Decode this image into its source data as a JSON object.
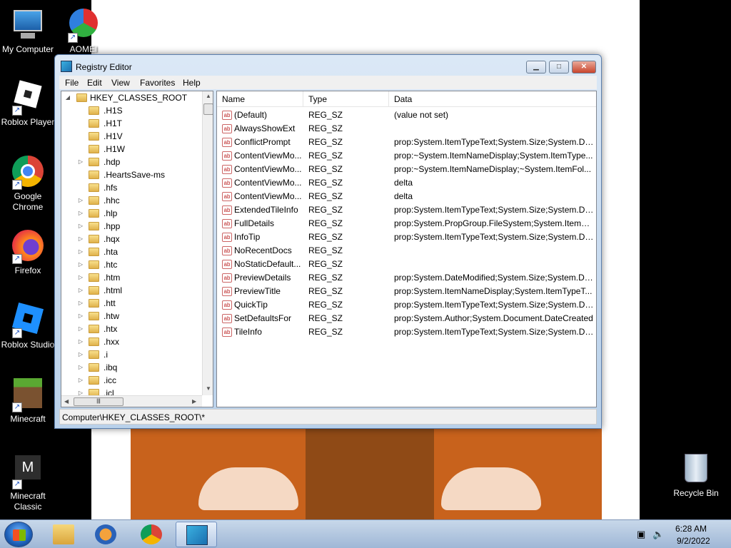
{
  "desktop": {
    "icons": [
      {
        "label": "My Computer",
        "icon": "computer-icon"
      },
      {
        "label": "AOMEI",
        "icon": "aomei-icon"
      },
      {
        "label": "Roblox Player",
        "icon": "roblox-icon"
      },
      {
        "label": "Google Chrome",
        "icon": "chrome-icon"
      },
      {
        "label": "Firefox",
        "icon": "firefox-icon"
      },
      {
        "label": "Roblox Studio",
        "icon": "roblox-studio-icon"
      },
      {
        "label": "Minecraft",
        "icon": "minecraft-icon"
      },
      {
        "label": "Minecraft Classic",
        "icon": "minecraft-classic-icon"
      },
      {
        "label": "Recycle Bin",
        "icon": "recycle-bin-icon"
      }
    ]
  },
  "window": {
    "title": "Registry Editor",
    "menu": [
      "File",
      "Edit",
      "View",
      "Favorites",
      "Help"
    ],
    "tree": {
      "root": "HKEY_CLASSES_ROOT",
      "items": [
        ".H1S",
        ".H1T",
        ".H1V",
        ".H1W",
        ".hdp",
        ".HeartsSave-ms",
        ".hfs",
        ".hhc",
        ".hlp",
        ".hpp",
        ".hqx",
        ".hta",
        ".htc",
        ".htm",
        ".html",
        ".htt",
        ".htw",
        ".htx",
        ".hxx",
        ".i",
        ".ibq",
        ".icc",
        ".icl"
      ]
    },
    "columns": {
      "name": "Name",
      "type": "Type",
      "data": "Data"
    },
    "values": [
      {
        "name": "(Default)",
        "type": "REG_SZ",
        "data": "(value not set)"
      },
      {
        "name": "AlwaysShowExt",
        "type": "REG_SZ",
        "data": ""
      },
      {
        "name": "ConflictPrompt",
        "type": "REG_SZ",
        "data": "prop:System.ItemTypeText;System.Size;System.Dat..."
      },
      {
        "name": "ContentViewMo...",
        "type": "REG_SZ",
        "data": "prop:~System.ItemNameDisplay;System.ItemType..."
      },
      {
        "name": "ContentViewMo...",
        "type": "REG_SZ",
        "data": "prop:~System.ItemNameDisplay;~System.ItemFol..."
      },
      {
        "name": "ContentViewMo...",
        "type": "REG_SZ",
        "data": "delta"
      },
      {
        "name": "ContentViewMo...",
        "type": "REG_SZ",
        "data": "delta"
      },
      {
        "name": "ExtendedTileInfo",
        "type": "REG_SZ",
        "data": "prop:System.ItemTypeText;System.Size;System.Dat..."
      },
      {
        "name": "FullDetails",
        "type": "REG_SZ",
        "data": "prop:System.PropGroup.FileSystem;System.ItemN..."
      },
      {
        "name": "InfoTip",
        "type": "REG_SZ",
        "data": "prop:System.ItemTypeText;System.Size;System.Dat..."
      },
      {
        "name": "NoRecentDocs",
        "type": "REG_SZ",
        "data": ""
      },
      {
        "name": "NoStaticDefault...",
        "type": "REG_SZ",
        "data": ""
      },
      {
        "name": "PreviewDetails",
        "type": "REG_SZ",
        "data": "prop:System.DateModified;System.Size;System.Dat..."
      },
      {
        "name": "PreviewTitle",
        "type": "REG_SZ",
        "data": "prop:System.ItemNameDisplay;System.ItemTypeT..."
      },
      {
        "name": "QuickTip",
        "type": "REG_SZ",
        "data": "prop:System.ItemTypeText;System.Size;System.Dat..."
      },
      {
        "name": "SetDefaultsFor",
        "type": "REG_SZ",
        "data": "prop:System.Author;System.Document.DateCreated"
      },
      {
        "name": "TileInfo",
        "type": "REG_SZ",
        "data": "prop:System.ItemTypeText;System.Size;System.Dat..."
      }
    ],
    "status": "Computer\\HKEY_CLASSES_ROOT\\*"
  },
  "taskbar": {
    "apps": [
      "explorer-icon",
      "media-player-icon",
      "chrome-icon",
      "registry-editor-icon"
    ],
    "time": "6:28 AM",
    "date": "9/2/2022"
  }
}
